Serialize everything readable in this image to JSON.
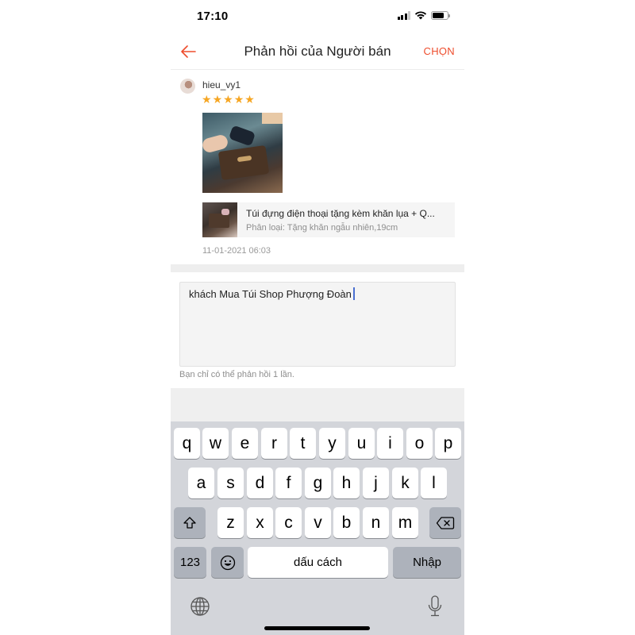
{
  "status_bar": {
    "time": "17:10",
    "signal_icon": "cellular-signal-icon",
    "wifi_icon": "wifi-icon",
    "battery_icon": "battery-icon",
    "battery_level": 0.78
  },
  "header": {
    "back_icon": "arrow-left-icon",
    "title": "Phản hồi của Người bán",
    "action_label": "CHỌN",
    "accent_color": "#ee4d2d"
  },
  "review": {
    "username": "hieu_vy1",
    "rating": 5,
    "rating_max": 5,
    "star_color": "#f6a623",
    "stars": [
      "★",
      "★",
      "★",
      "★",
      "★"
    ],
    "product": {
      "name": "Túi đựng điện thoại tặng kèm khăn lụa + Quà tặng",
      "name_display": "Túi đựng điện thoại tặng kèm khăn lụa + Q...",
      "variant": "Phân loại: Tặng khăn ngẫu nhiên,19cm"
    },
    "timestamp": "11-01-2021 06:03"
  },
  "reply": {
    "value": "khách Mua Túi Shop Phượng Đoàn",
    "hint": "Bạn chỉ có thể phản hồi 1 lần."
  },
  "keyboard": {
    "row1": [
      "q",
      "w",
      "e",
      "r",
      "t",
      "y",
      "u",
      "i",
      "o",
      "p"
    ],
    "row2": [
      "a",
      "s",
      "d",
      "f",
      "g",
      "h",
      "j",
      "k",
      "l"
    ],
    "row3": [
      "z",
      "x",
      "c",
      "v",
      "b",
      "n",
      "m"
    ],
    "shift_icon": "shift-icon",
    "delete_icon": "backspace-icon",
    "numbers_label": "123",
    "emoji_icon": "emoji-icon",
    "space_label": "dấu cách",
    "return_label": "Nhập",
    "globe_icon": "globe-icon",
    "mic_icon": "microphone-icon"
  }
}
